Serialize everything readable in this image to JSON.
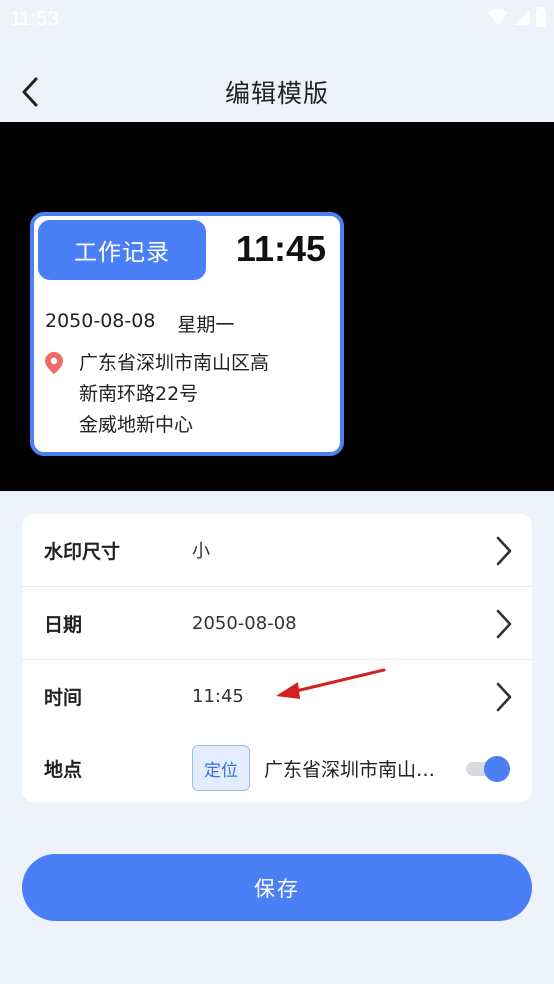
{
  "status_bar": {
    "time": "11:53"
  },
  "header": {
    "title": "编辑模版"
  },
  "watermark": {
    "badge": "工作记录",
    "time": "11:45",
    "date": "2050-08-08",
    "weekday": "星期一",
    "address_lines": [
      "广东省深圳市南山区高",
      "新南环路22号",
      "金威地新中心"
    ]
  },
  "settings": {
    "size": {
      "label": "水印尺寸",
      "value": "小"
    },
    "date": {
      "label": "日期",
      "value": "2050-08-08"
    },
    "time": {
      "label": "时间",
      "value": "11:45"
    },
    "location": {
      "label": "地点",
      "locate_button": "定位",
      "value": "广东省深圳市南山区高新南环路22号金威地新中心",
      "enabled": true
    }
  },
  "save_button": "保存",
  "colors": {
    "accent": "#4a7ff5",
    "preview_bg": "#000000",
    "page_bg": "#eef3fb",
    "arrow": "#d42020"
  },
  "icons": [
    "wifi-icon",
    "signal-icon",
    "battery-icon",
    "back-arrow-icon",
    "location-pin-icon",
    "chevron-right-icon"
  ]
}
